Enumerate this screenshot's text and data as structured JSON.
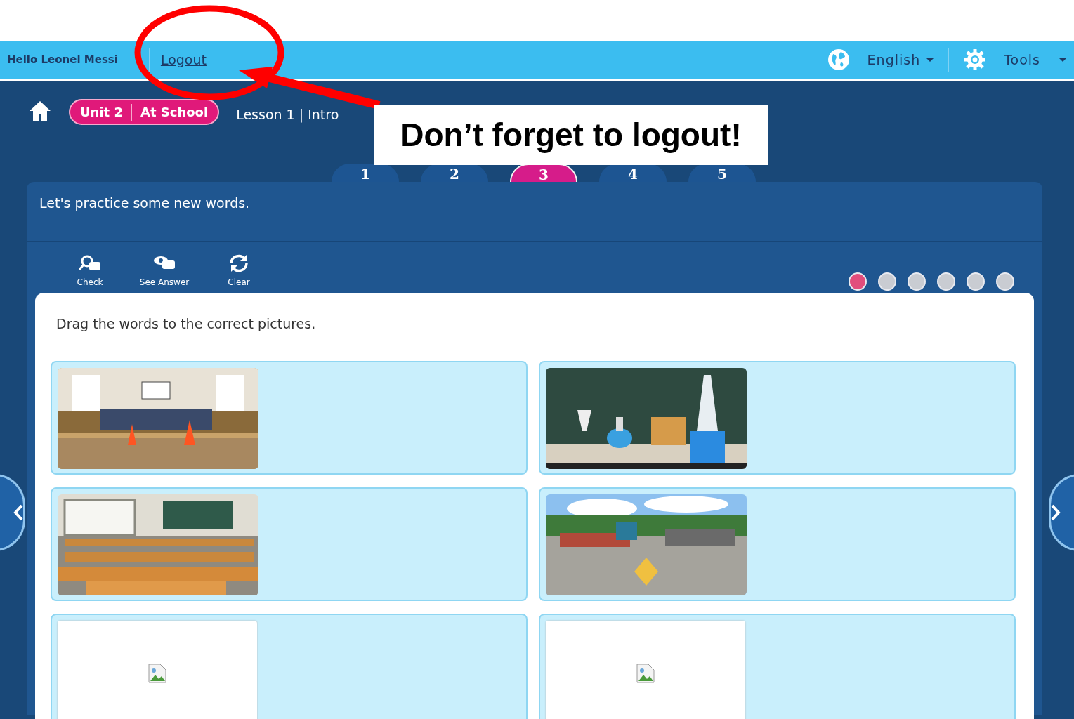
{
  "top_bar": {
    "greeting": "Hello Leonel Messi",
    "logout": "Logout",
    "language": "English",
    "tools": "Tools"
  },
  "breadcrumb": {
    "unit": "Unit 2",
    "unit_title": "At School",
    "lesson": "Lesson 1 | Intro"
  },
  "steps": [
    {
      "label": "1",
      "selected": false
    },
    {
      "label": "2",
      "selected": false
    },
    {
      "label": "3",
      "selected": true
    },
    {
      "label": "4",
      "selected": false
    },
    {
      "label": "5",
      "selected": false
    }
  ],
  "panel": {
    "prompt": "Let's practice some new words.",
    "tools": [
      {
        "kind": "check",
        "label": "Check"
      },
      {
        "kind": "answer",
        "label": "See Answer"
      },
      {
        "kind": "clear",
        "label": "Clear"
      }
    ],
    "pages": [
      {
        "selected": true
      },
      {
        "selected": false
      },
      {
        "selected": false
      },
      {
        "selected": false
      },
      {
        "selected": false
      },
      {
        "selected": false
      }
    ]
  },
  "activity": {
    "instruction": "Drag the words to the correct pictures.",
    "cards": [
      {
        "kind": "picture"
      },
      {
        "kind": "picture"
      },
      {
        "kind": "picture"
      },
      {
        "kind": "picture"
      },
      {
        "kind": "broken_image"
      },
      {
        "kind": "broken_image"
      }
    ]
  },
  "annotation": {
    "callout": "Don’t forget to logout!"
  }
}
